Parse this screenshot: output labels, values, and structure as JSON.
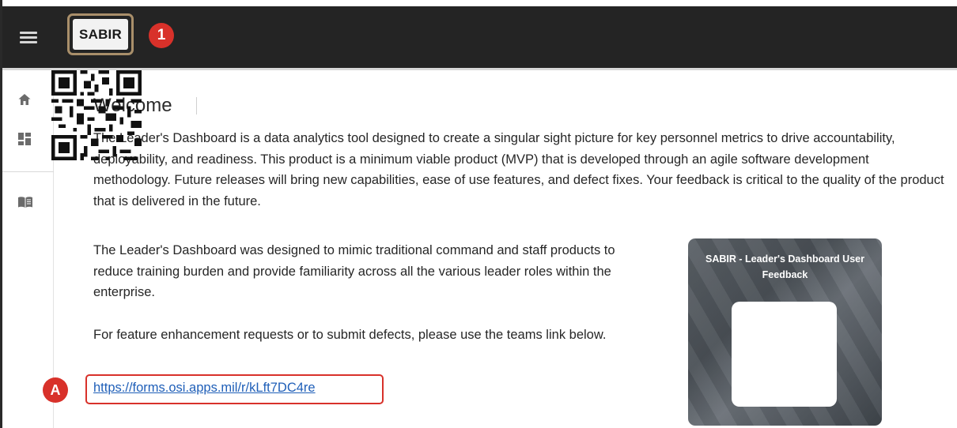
{
  "header": {
    "logo_text": "SABIR",
    "callout_1": "1"
  },
  "sidebar": {
    "items": [
      {
        "icon": "home-icon"
      },
      {
        "icon": "dashboard-icon"
      },
      {
        "icon": "book-icon"
      }
    ]
  },
  "main": {
    "title": "Welcome",
    "intro": "The Leader's Dashboard is a data analytics tool designed to create a singular sight picture for key personnel metrics to drive accountability, deployability, and readiness. This product is a minimum viable product (MVP) that is developed through an agile software development methodology. Future releases will bring new capabilities, ease of use features, and defect fixes. Your feedback is critical to the quality of the product that is delivered in the future.",
    "paragraph2": "The Leader's Dashboard was designed to mimic traditional command and staff products to reduce training burden and provide familiarity across all the various leader roles within the enterprise.",
    "paragraph3": "For feature enhancement requests or to submit defects, please use the teams link below.",
    "link_text": "https://forms.osi.apps.mil/r/kLft7DC4re",
    "callout_a": "A"
  },
  "qr_card": {
    "title": "SABIR - Leader's Dashboard User Feedback"
  },
  "colors": {
    "topbar": "#242424",
    "callout": "#d8312a",
    "link": "#1f5fb8",
    "logo_border": "#a98f6a"
  }
}
